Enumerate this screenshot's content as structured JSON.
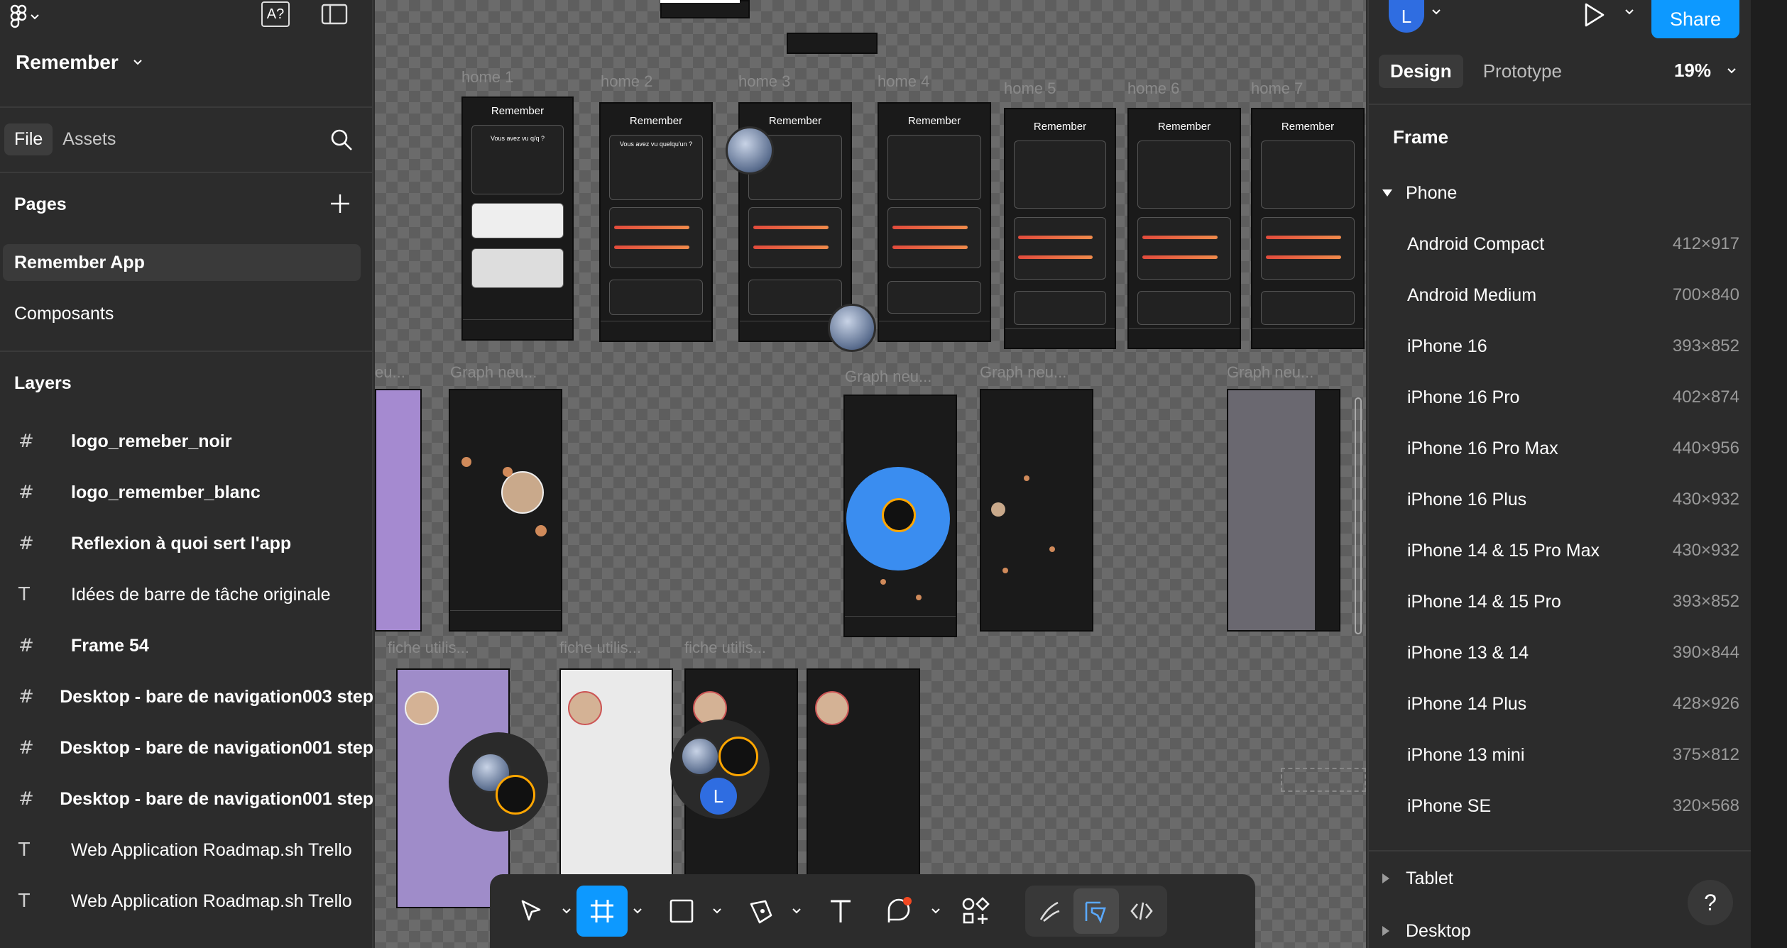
{
  "app": {
    "file_name": "Remember"
  },
  "left_panel": {
    "tabs": [
      "File",
      "Assets"
    ],
    "pages_heading": "Pages",
    "pages": [
      "Remember App",
      "Composants"
    ],
    "layers_heading": "Layers",
    "layers": [
      {
        "type": "frame",
        "label": "logo_remeber_noir"
      },
      {
        "type": "frame",
        "label": "logo_remember_blanc"
      },
      {
        "type": "frame",
        "label": "Reflexion à quoi sert l'app"
      },
      {
        "type": "text",
        "label": "Idées de barre de tâche originale"
      },
      {
        "type": "frame",
        "label": "Frame 54"
      },
      {
        "type": "frame",
        "label": "Desktop - bare de navigation003 step"
      },
      {
        "type": "frame",
        "label": "Desktop - bare de navigation001 step"
      },
      {
        "type": "frame",
        "label": "Desktop - bare de navigation001 step"
      },
      {
        "type": "text",
        "label": "Web Application Roadmap.sh Trello"
      },
      {
        "type": "text",
        "label": "Web Application Roadmap.sh Trello"
      }
    ]
  },
  "canvas": {
    "frame_labels": {
      "home1": "home 1",
      "home2": "home 2",
      "home3": "home 3",
      "home4": "home 4",
      "home5": "home 5",
      "home6": "home 6",
      "home7": "home 7",
      "graph1": "Graph neu...",
      "graph2": "Graph neu...",
      "graph3": "Graph neu...",
      "graph4": "Graph neu...",
      "graph0": "eu...",
      "fiche1": "fiche utilis...",
      "fiche2": "fiche utilis...",
      "fiche3": "fiche utilis..."
    },
    "phone_title": "Remember",
    "phone_question": "Vous avez vu quelqu'un ?",
    "phone_question_short": "Vous avez vu q/q ?",
    "collab_initial": "L"
  },
  "toolbar": {
    "tools": [
      "move-tool",
      "frame-tool",
      "shape-tool",
      "pen-tool",
      "text-tool",
      "comment-tool",
      "actions-tool"
    ],
    "modes": [
      "draw-mode",
      "design-mode",
      "dev-mode"
    ]
  },
  "right_panel": {
    "user_initial": "L",
    "share_label": "Share",
    "tabs": [
      "Design",
      "Prototype"
    ],
    "zoom": "19%",
    "frame_heading": "Frame",
    "phone_group": "Phone",
    "presets": [
      {
        "name": "Android Compact",
        "size": "412×917"
      },
      {
        "name": "Android Medium",
        "size": "700×840"
      },
      {
        "name": "iPhone 16",
        "size": "393×852"
      },
      {
        "name": "iPhone 16 Pro",
        "size": "402×874"
      },
      {
        "name": "iPhone 16 Pro Max",
        "size": "440×956"
      },
      {
        "name": "iPhone 16 Plus",
        "size": "430×932"
      },
      {
        "name": "iPhone 14 & 15 Pro Max",
        "size": "430×932"
      },
      {
        "name": "iPhone 14 & 15 Pro",
        "size": "393×852"
      },
      {
        "name": "iPhone 13 & 14",
        "size": "390×844"
      },
      {
        "name": "iPhone 14 Plus",
        "size": "428×926"
      },
      {
        "name": "iPhone 13 mini",
        "size": "375×812"
      },
      {
        "name": "iPhone SE",
        "size": "320×568"
      }
    ],
    "tablet_group": "Tablet",
    "desktop_group": "Desktop",
    "help": "?"
  },
  "colors": {
    "accent": "#0d99ff",
    "panel": "#2c2c2c",
    "avatar": "#2f6de1"
  }
}
